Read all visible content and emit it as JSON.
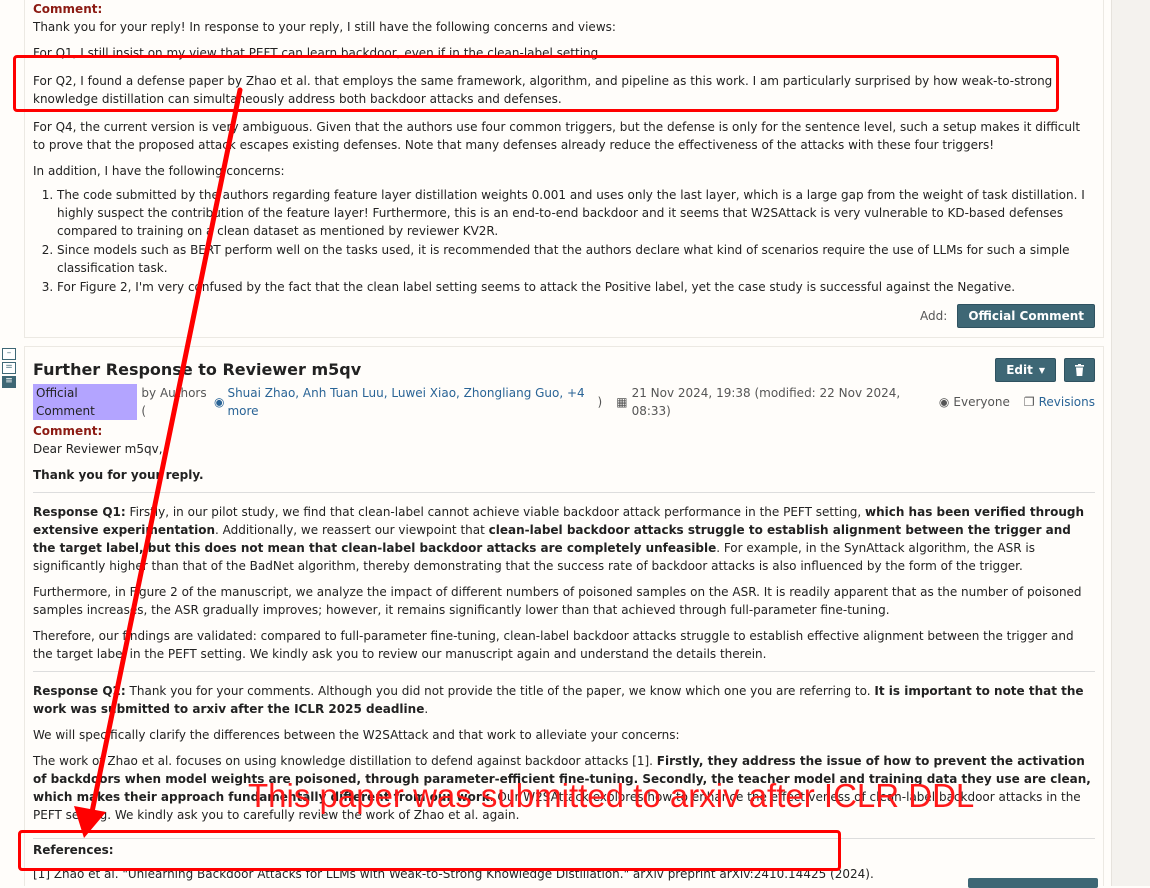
{
  "note1": {
    "comment_label": "Comment:",
    "para_intro": "Thank you for your reply! In response to your reply, I still have the following concerns and views:",
    "para_q1": "For Q1, I still insist on my view that PEFT can learn backdoor, even if in the clean-label setting.",
    "para_q2": "For Q2, I found a defense paper by Zhao et al. that employs the same framework, algorithm, and pipeline as this work. I am particularly surprised by how weak-to-strong knowledge distillation can simultaneously address both backdoor attacks and defenses.",
    "para_q4": "For Q4, the current version is very ambiguous. Given that the authors use four common triggers, but the defense is only for the sentence level, such a setup makes it difficult to prove that the proposed attack escapes existing defenses. Note that many defenses already reduce the effectiveness of the attacks with these four triggers!",
    "para_concerns": "In addition, I have the following concerns:",
    "list": [
      "The code submitted by the authors regarding feature layer distillation weights 0.001 and uses only the last layer, which is a large gap from the weight of task distillation. I highly suspect the contribution of the feature layer! Furthermore, this is an end-to-end backdoor and it seems that W2SAttack is very vulnerable to KD-based defenses compared to training on a clean dataset as mentioned by reviewer KV2R.",
      "Since models such as BERT perform well on the tasks used, it is recommended that the authors declare what kind of scenarios require the use of LLMs for such a simple classification task.",
      "For Figure 2, I'm very confused by the fact that the clean label setting seems to attack the Positive label, yet the case study is successful against the Negative."
    ],
    "add_label": "Add:",
    "official_comment_button": "Official Comment"
  },
  "note2": {
    "title": "Further Response to Reviewer m5qv",
    "edit_button": "Edit",
    "badge": "Official Comment",
    "by_text": "by Authors (",
    "authors": "Shuai Zhao, Anh Tuan Luu, Luwei Xiao, Zhongliang Guo, +4 more",
    "close_paren": ")",
    "date": "21 Nov 2024, 19:38 (modified: 22 Nov 2024, 08:33)",
    "readers": "Everyone",
    "revisions": "Revisions",
    "comment_label": "Comment:",
    "greeting": "Dear Reviewer m5qv,",
    "thanks": "Thank you for your reply.",
    "rq1_label": "Response Q1:",
    "rq1_a": " Firstly, in our pilot study, we find that clean-label cannot achieve viable backdoor attack performance in the PEFT setting, ",
    "rq1_b": "which has been verified through extensive experimentation",
    "rq1_c": ". Additionally, we reassert our viewpoint that ",
    "rq1_d": "clean-label backdoor attacks struggle to establish alignment between the trigger and the target label, but this does not mean that clean-label backdoor attacks are completely unfeasible",
    "rq1_e": ". For example, in the SynAttack algorithm, the ASR is significantly higher than that of the BadNet algorithm, thereby demonstrating that the success rate of backdoor attacks is also influenced by the form of the trigger.",
    "rq1_p2": "Furthermore, in Figure 2 of the manuscript, we analyze the impact of different numbers of poisoned samples on the ASR. It is readily apparent that as the number of poisoned samples increases, the ASR gradually improves; however, it remains significantly lower than that achieved through full-parameter fine-tuning.",
    "rq1_p3": "Therefore, our findings are validated: compared to full-parameter fine-tuning, clean-label backdoor attacks struggle to establish effective alignment between the trigger and the target label in the PEFT setting. We kindly ask you to review our manuscript again and understand the details therein.",
    "rq2_label": "Response Q2:",
    "rq2_a": " Thank you for your comments. Although you did not provide the title of the paper, we know which one you are referring to. ",
    "rq2_b": "It is important to note that the work was submitted to arxiv after the ICLR 2025 deadline",
    "rq2_c": ".",
    "rq2_p2": "We will specifically clarify the differences between the W2SAttack and that work to alleviate your concerns:",
    "rq2_p3a": "The work of Zhao et al. focuses on using knowledge distillation to defend against backdoor attacks [1]. ",
    "rq2_p3b": "Firstly, they address the issue of how to prevent the activation of backdoors when model weights are poisoned, through parameter-efficient fine-tuning. Secondly, the teacher model and training data they use are clean, which makes their approach fundamentally different from our work",
    "rq2_p3c": ". Our W2SAttack explores how to enhance the effectiveness of clean-label backdoor attacks in the PEFT setting. We kindly ask you to carefully review the work of Zhao et al. again.",
    "references_label": "References:",
    "reference_1": "[1] Zhao et al. \"Unlearning Backdoor Attacks for LLMs with Weak-to-Strong Knowledge Distillation.\" arXiv preprint arXiv:2410.14425 (2024)."
  },
  "annotation": {
    "text": "This paper was submitted to arxiv after ICLR DDL",
    "color": "#ff1a1a"
  },
  "colors": {
    "button": "#3e6775",
    "comment_label": "#8c1b13",
    "badge": "#b3a4ff",
    "link": "#2a6496"
  }
}
